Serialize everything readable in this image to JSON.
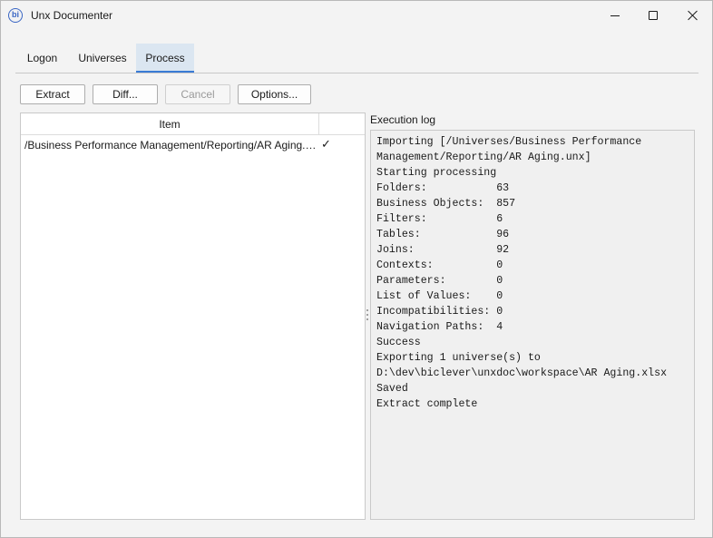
{
  "window": {
    "title": "Unx Documenter",
    "icon": "bi-logo-icon",
    "accent_color": "#3a7bd5"
  },
  "tabs": [
    {
      "label": "Logon",
      "active": false
    },
    {
      "label": "Universes",
      "active": false
    },
    {
      "label": "Process",
      "active": true
    }
  ],
  "toolbar": {
    "extract_label": "Extract",
    "diff_label": "Diff...",
    "cancel_label": "Cancel",
    "options_label": "Options..."
  },
  "items_table": {
    "columns": [
      "Item",
      ""
    ],
    "rows": [
      {
        "item": "/Business Performance Management/Reporting/AR Aging.unx",
        "status": "✓"
      }
    ]
  },
  "log": {
    "label": "Execution log",
    "lines": [
      "Importing [/Universes/Business Performance",
      "Management/Reporting/AR Aging.unx]",
      "Starting processing",
      "Folders:           63",
      "Business Objects:  857",
      "Filters:           6",
      "Tables:            96",
      "Joins:             92",
      "Contexts:          0",
      "Parameters:        0",
      "List of Values:    0",
      "Incompatibilities: 0",
      "Navigation Paths:  4",
      "Success",
      "Exporting 1 universe(s) to",
      "D:\\dev\\biclever\\unxdoc\\workspace\\AR Aging.xlsx",
      "Saved",
      "Extract complete"
    ]
  }
}
